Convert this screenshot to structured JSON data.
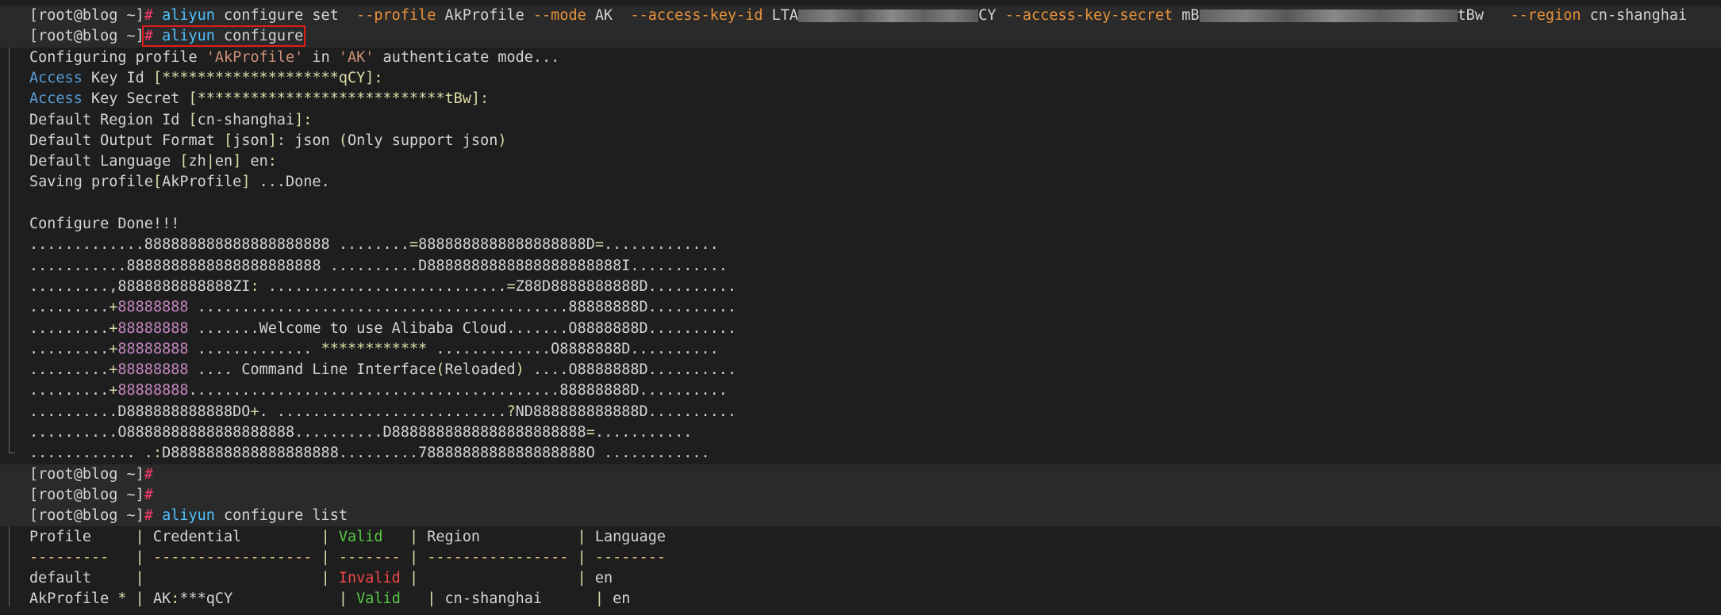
{
  "lines": {
    "l0": {
      "prompt": "[root@blog ~]",
      "hash": "#",
      "cmd": "aliyun",
      "rest": " configure set  ",
      "profile_flag": "--profile",
      "profile_val": " AkProfile ",
      "mode_flag": "--mode",
      "mode_val": " AK  ",
      "keyid_flag": "--access-key-id",
      "keyid_pre": " LTA",
      "keyid_post": "CY ",
      "secret_flag": "--access-key-secret",
      "secret_pre": " mB",
      "secret_post": "tBw   ",
      "region_flag": "--region",
      "region_val": " cn-shanghai"
    },
    "l1": {
      "prompt": "[root@blog ~]",
      "hash": "#",
      "cmd": "aliyun",
      "rest": " configure"
    },
    "l2": {
      "pre": "Configuring profile ",
      "q1": "'AkProfile'",
      "mid": " in ",
      "q2": "'AK'",
      "post": " authenticate mode..."
    },
    "l3": {
      "a": "Access",
      "b": " Key Id ",
      "c": "[",
      "d": "********************qCY",
      "e": "]",
      "f": ":"
    },
    "l4": {
      "a": "Access",
      "b": " Key Secret ",
      "c": "[",
      "d": "****************************tBw",
      "e": "]",
      "f": ":"
    },
    "l5": {
      "a": "Default Region Id ",
      "b": "[",
      "c": "cn-shanghai",
      "d": "]",
      "e": ":"
    },
    "l6": {
      "a": "Default Output Format ",
      "b": "[",
      "c": "json",
      "d": "]",
      "e": ": json ",
      "f": "(",
      "g": "Only support json",
      "h": ")"
    },
    "l7": {
      "a": "Default Language ",
      "b": "[",
      "c": "zh",
      "d": "|",
      "e": "en",
      "f": "]",
      "g": " en",
      "h": ":"
    },
    "l8": {
      "a": "Saving profile",
      "b": "[",
      "c": "AkProfile",
      "d": "]",
      "e": " ...Done."
    },
    "l10": {
      "a": "Configure Done!!!"
    },
    "l11": {
      "a": ".............888888888888888888888 ........",
      "b": "=",
      "c": "8888888888888888888D",
      "d": "=",
      "e": "............."
    },
    "l12": {
      "a": "...........8888888888888888888888 ..........D8888888888888888888888I..........."
    },
    "l13": {
      "a": ".........,8888888888888ZI",
      "b": ":",
      "c": " ...........................",
      "d": "=",
      "e": "Z88D8888888888D.........."
    },
    "l14": {
      "a": ".........",
      "b": "+",
      "c": "88888888",
      "d": " ..........................................88888888D.........."
    },
    "l15": {
      "a": ".........",
      "b": "+",
      "c": "88888888",
      "d": " .......Welcome to use Alibaba Cloud.......O8888888D.........."
    },
    "l16": {
      "a": ".........",
      "b": "+",
      "c": "88888888",
      "d": " ............. ",
      "e": "************",
      "f": " .............O8888888D.........."
    },
    "l17": {
      "a": ".........",
      "b": "+",
      "c": "88888888",
      "d": " .... Command Line Interface",
      "e": "(",
      "f": "Reloaded",
      "g": ")",
      "h": " ....O8888888D.........."
    },
    "l18": {
      "a": ".........",
      "b": "+",
      "c": "88888888",
      "d": "..........................................88888888D.........."
    },
    "l19": {
      "a": "..........D888888888888DO",
      "b": "+",
      "c": ". ..........................",
      "d": "?",
      "e": "ND888888888888D.........."
    },
    "l20": {
      "a": "..........O8888888888888888888..........D8888888888888888888888",
      "b": "=",
      "c": "..........."
    },
    "l21": {
      "a": "............ .",
      "b": ":",
      "c": "D8888888888888888888.........7888888888888888888O ............"
    },
    "l22": {
      "prompt": "[root@blog ~]",
      "hash": "#"
    },
    "l23": {
      "prompt": "[root@blog ~]",
      "hash": "#"
    },
    "l24": {
      "prompt": "[root@blog ~]",
      "hash": "#",
      "cmd": "aliyun",
      "rest": " configure list"
    },
    "l25": {
      "a": "Profile     ",
      "b": "|",
      "c": " Credential         ",
      "d": "|",
      "e": " ",
      "f": "Valid",
      "g": "   ",
      "h": "|",
      "i": " Region           ",
      "j": "|",
      "k": " Language"
    },
    "l26": {
      "a": "---------",
      "b": "   ",
      "c": "|",
      "d": " ",
      "e": "------------------",
      "f": " ",
      "g": "|",
      "h": " ",
      "i": "-------",
      "j": " ",
      "k": "|",
      "l": " ",
      "m": "----------------",
      "n": " ",
      "o": "|",
      "p": " ",
      "q": "--------"
    },
    "l27": {
      "a": "default     ",
      "b": "|",
      "c": "                    ",
      "d": "|",
      "e": " ",
      "f": "Invalid",
      "g": " ",
      "h": "|",
      "i": "                  ",
      "j": "|",
      "k": " en"
    },
    "l28": {
      "a": "AkProfile ",
      "b": "*",
      "c": " ",
      "d": "|",
      "e": " AK",
      "f": ":",
      "g": "***qCY",
      "h": "            ",
      "i": "|",
      "j": " ",
      "k": "Valid",
      "l": "   ",
      "m": "|",
      "n": " cn-shanghai      ",
      "o": "|",
      "p": " en"
    }
  },
  "colors": {
    "background": "#1e1e1e",
    "prompt_hash": "#ff3d6e",
    "command": "#4fc1ff",
    "flag": "#e8923b",
    "quote": "#ce9178",
    "access": "#569cd6",
    "bracket": "#dcdcaa",
    "valid": "#56c842",
    "invalid": "#f44747",
    "logo_purple": "#c586c0",
    "highlight_box": "#e41b1b"
  },
  "icons": {
    "fold_1": "fold-collapse-icon",
    "fold_2": "fold-collapse-icon"
  }
}
